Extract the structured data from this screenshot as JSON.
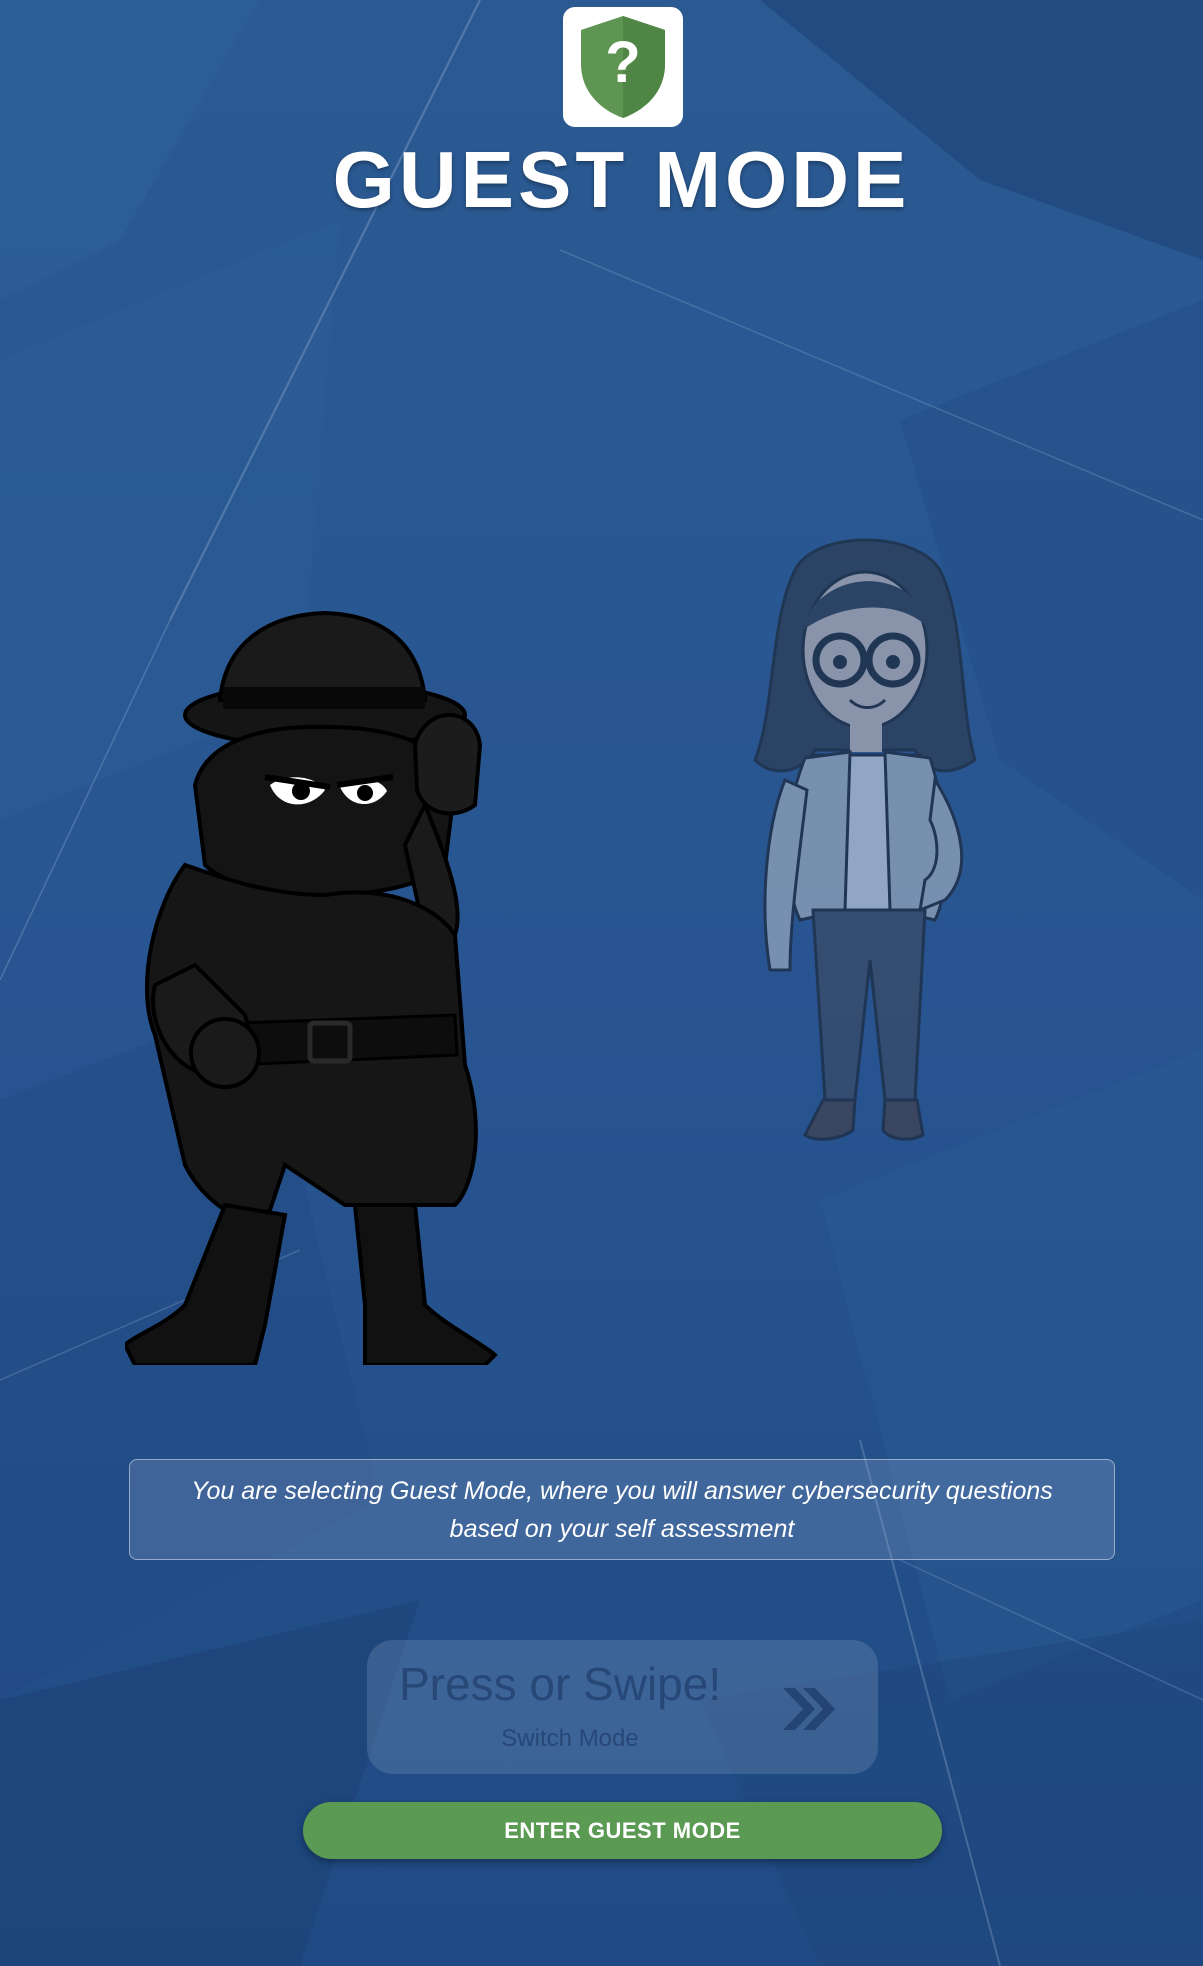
{
  "app": {
    "title": "GUEST MODE",
    "logo_icon": "shield-question-icon",
    "accent_color": "#5a9a53",
    "background_color": "#2a5690"
  },
  "characters": {
    "selected": "spy-character",
    "alternate": "professional-woman-character"
  },
  "description": {
    "text": "You are selecting Guest Mode, where you will answer cybersecurity questions based on your self assessment"
  },
  "swipe_control": {
    "main_label": "Press or Swipe!",
    "sub_label": "Switch Mode",
    "icon": "double-chevron-right-icon"
  },
  "enter_button": {
    "label": "ENTER GUEST MODE"
  }
}
